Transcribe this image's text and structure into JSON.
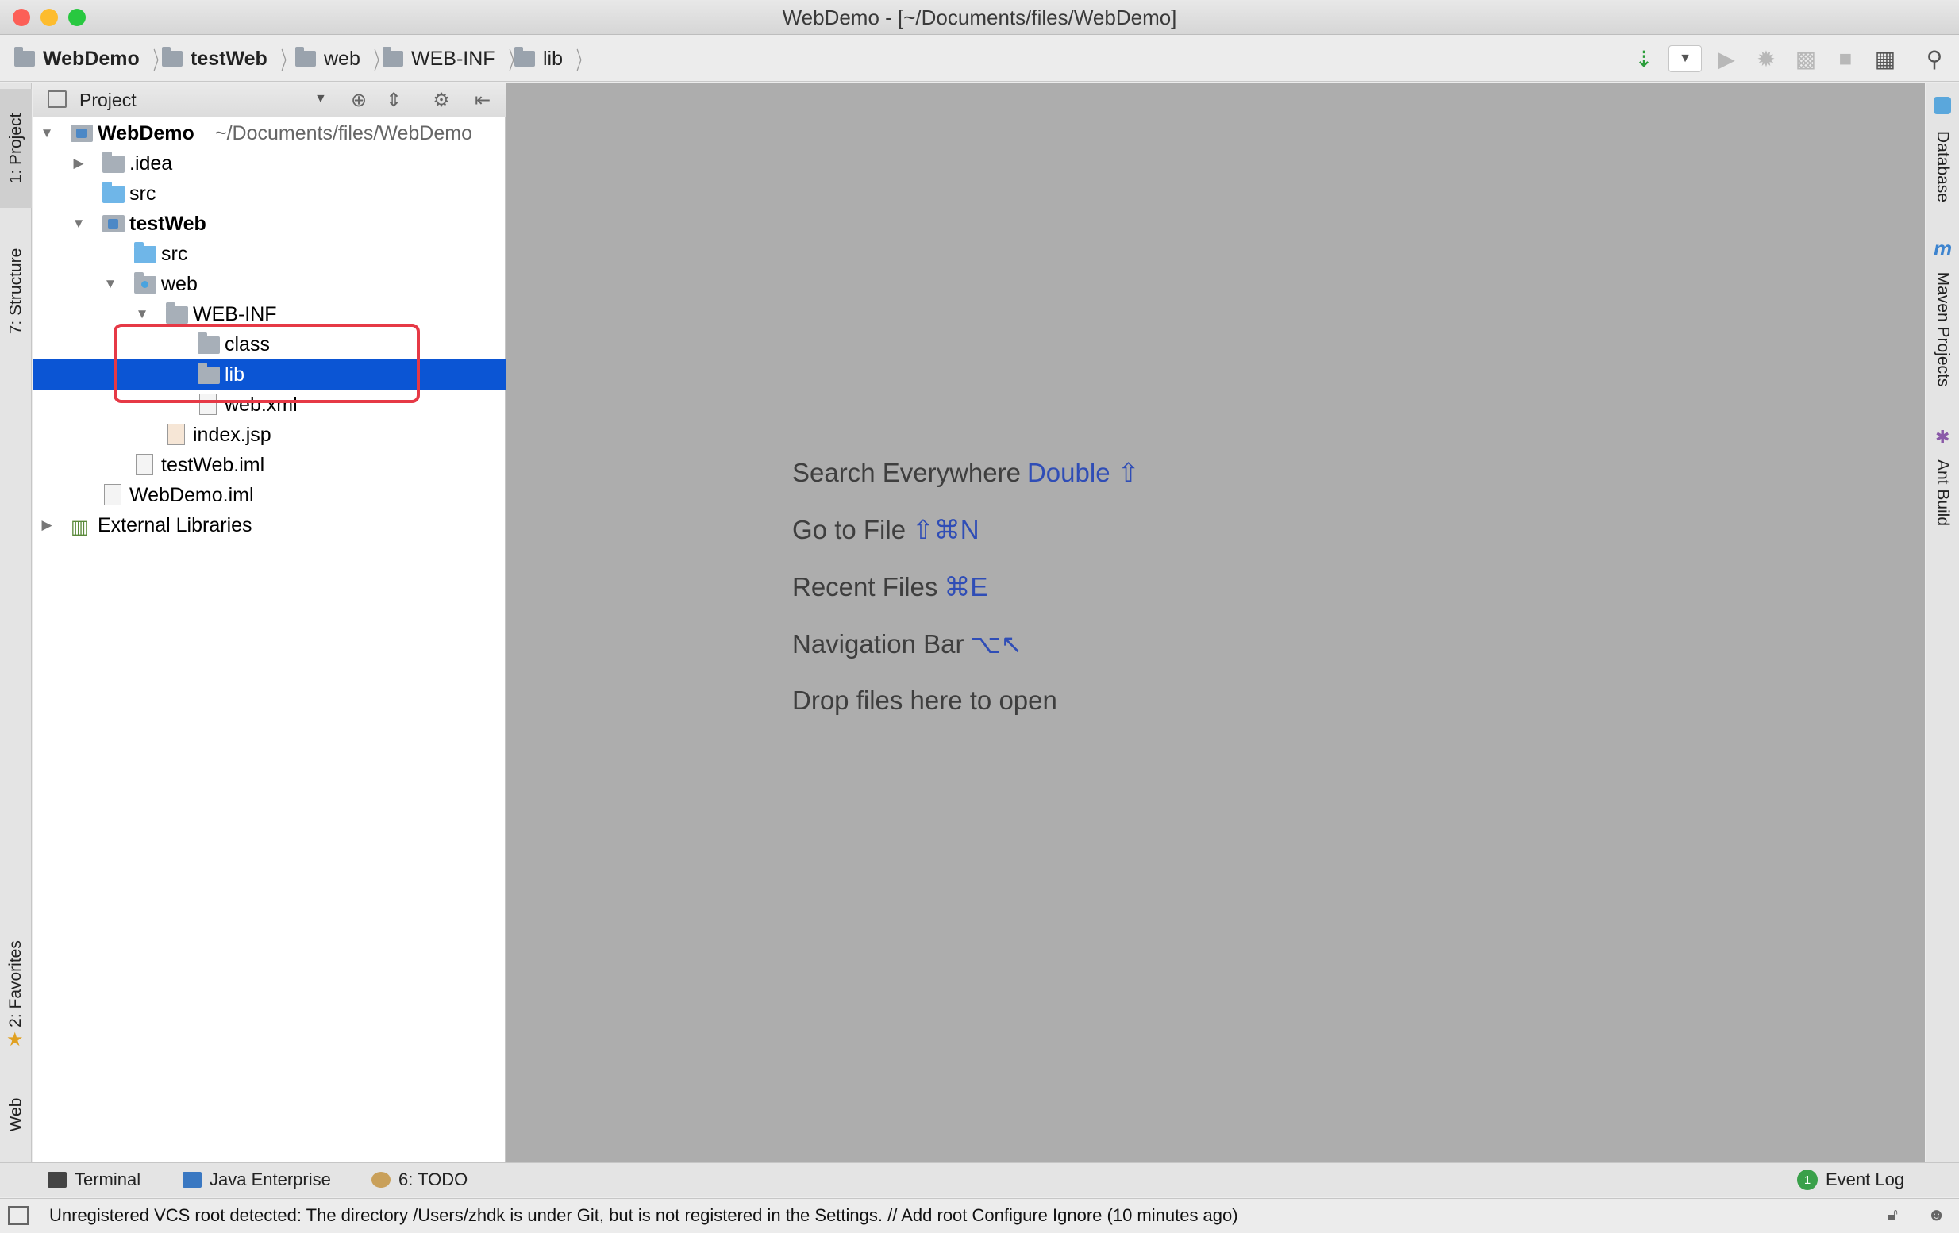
{
  "window": {
    "title": "WebDemo - [~/Documents/files/WebDemo]",
    "traffic_lights": [
      "#fc5f57",
      "#fdbc2e",
      "#28c840"
    ]
  },
  "breadcrumb": [
    "WebDemo",
    "testWeb",
    "web",
    "WEB-INF",
    "lib"
  ],
  "left_tabs": {
    "project": "1: Project",
    "structure": "7: Structure",
    "favorites": "2: Favorites",
    "web": "Web"
  },
  "right_tabs": {
    "database": "Database",
    "maven": "Maven Projects",
    "ant": "Ant Build"
  },
  "project_panel": {
    "title": "Project",
    "tree": {
      "root_name": "WebDemo",
      "root_path": "~/Documents/files/WebDemo",
      "idea": ".idea",
      "src1": "src",
      "testweb": "testWeb",
      "src2": "src",
      "web": "web",
      "webinf": "WEB-INF",
      "class": "class",
      "lib": "lib",
      "webxml": "web.xml",
      "indexjsp": "index.jsp",
      "testwebiml": "testWeb.iml",
      "webdemoiml": "WebDemo.iml",
      "extlibs": "External Libraries"
    },
    "selected_item": "lib"
  },
  "editor_hints": [
    {
      "text": "Search Everywhere",
      "key": "Double ⇧"
    },
    {
      "text": "Go to File",
      "key": "⇧⌘N"
    },
    {
      "text": "Recent Files",
      "key": "⌘E"
    },
    {
      "text": "Navigation Bar",
      "key": "⌥↖"
    },
    {
      "text": "Drop files here to open",
      "key": ""
    }
  ],
  "bottom_tabs": {
    "terminal": "Terminal",
    "java_enterprise": "Java Enterprise",
    "todo": "6: TODO",
    "event_log": "Event Log",
    "event_count": "1"
  },
  "status": "Unregistered VCS root detected: The directory /Users/zhdk is under Git, but is not registered in the Settings. // Add root  Configure  Ignore (10 minutes ago)",
  "colors": {
    "selection": "#0b55d4",
    "highlight_box": "#e63946",
    "editor_bg": "#adadad",
    "key_hint": "#2f4db6"
  }
}
